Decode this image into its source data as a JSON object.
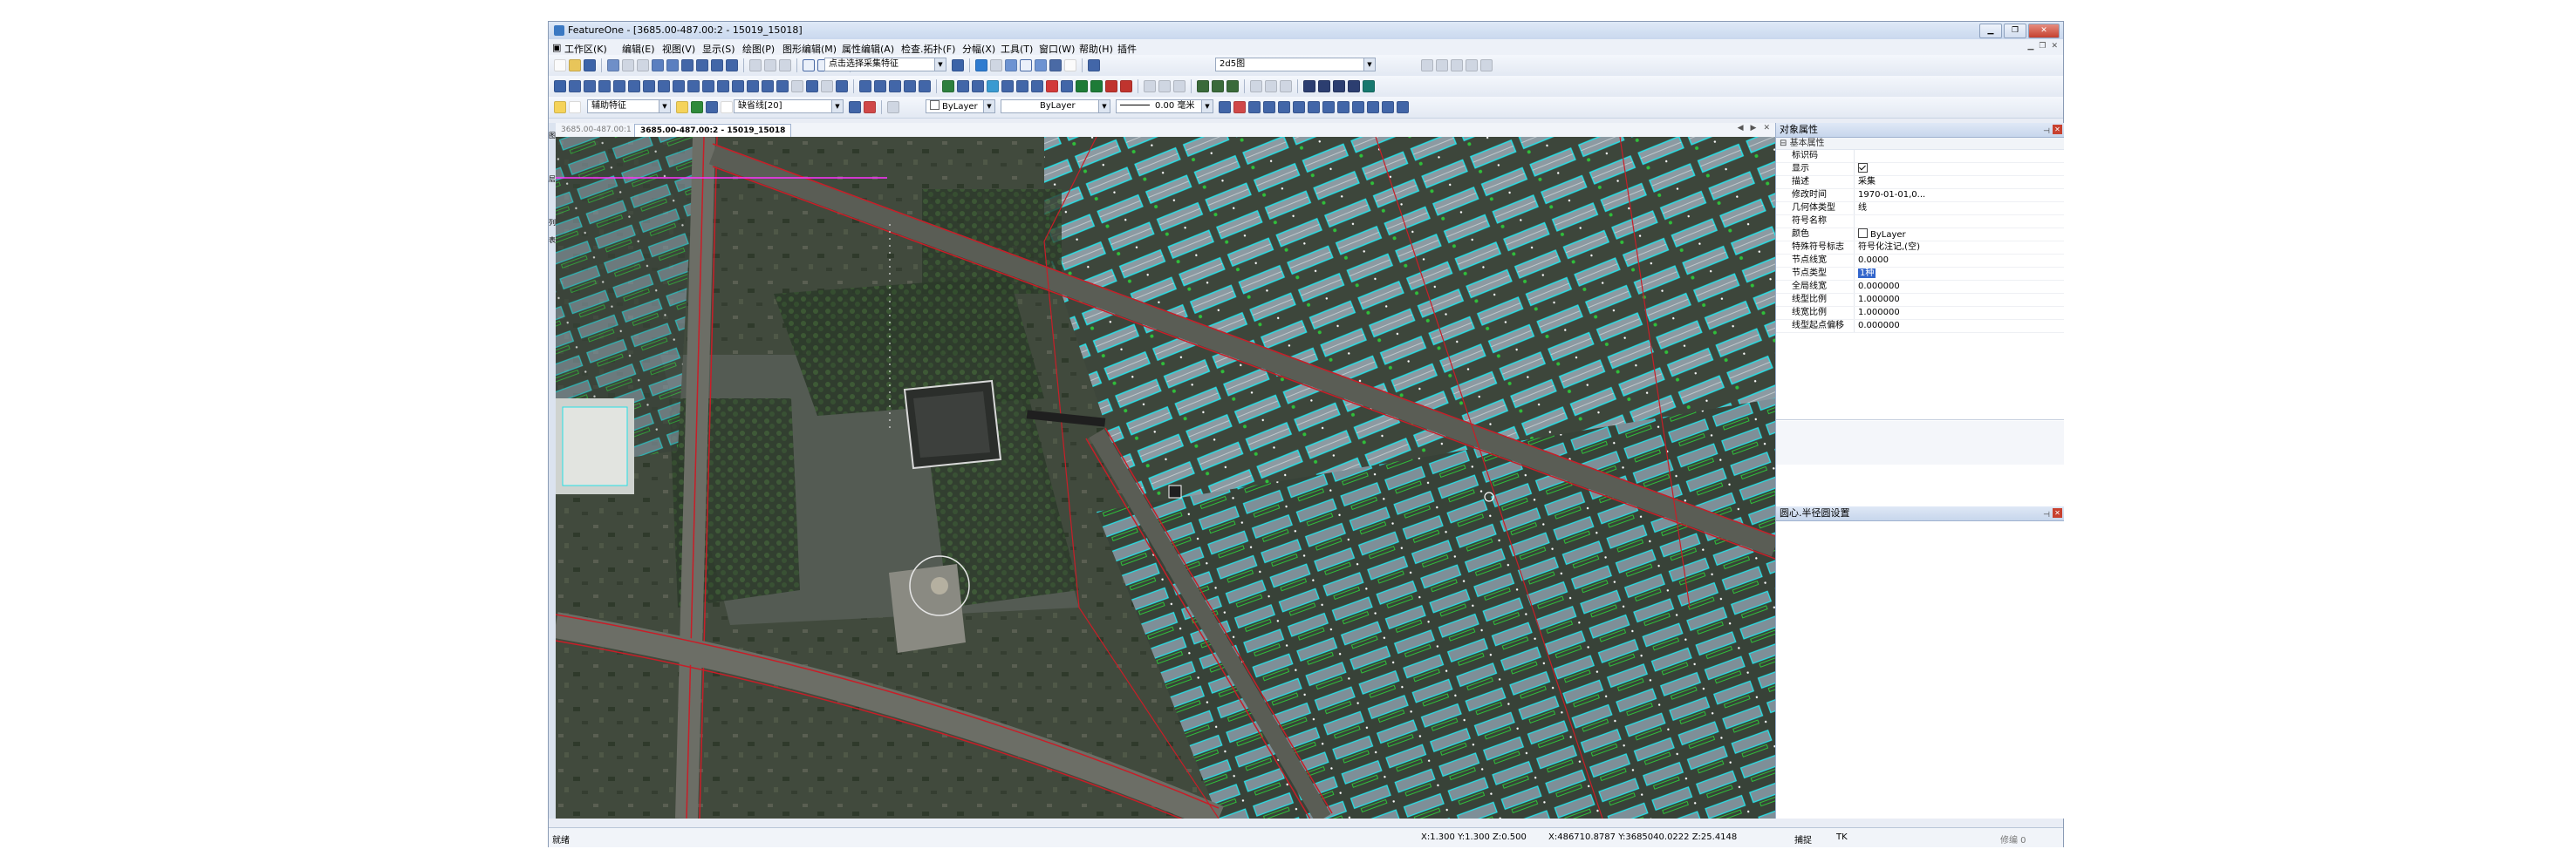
{
  "window": {
    "title": "FeatureOne - [3685.00-487.00:2 - 15019_15018]"
  },
  "menu": [
    "工作区(K)",
    "编辑(E)",
    "视图(V)",
    "显示(S)",
    "绘图(P)",
    "图形编辑(M)",
    "属性编辑(A)",
    "检查.拓扑(F)",
    "分幅(X)",
    "工具(T)",
    "窗口(W)",
    "帮助(H)",
    "插件"
  ],
  "toolbar1": {
    "select_mode": "点击选择采集特征",
    "layer": "2d5图"
  },
  "toolbar3": {
    "aux_feature_label": "辅助特征",
    "missing_line": "缺省线[20]",
    "bylayer_color": "ByLayer",
    "bylayer_linetype": "ByLayer",
    "line_width": "0.00 毫米"
  },
  "tabs": {
    "inactive": "3685.00-487.00:1",
    "active": "3685.00-487.00:2 - 15019_15018"
  },
  "left_strip": [
    "图",
    "层",
    "列",
    "表"
  ],
  "properties_panel": {
    "title": "对象属性",
    "group": "基本属性",
    "rows": [
      {
        "key": "标识码",
        "value": ""
      },
      {
        "key": "显示",
        "value": "",
        "checkbox": true
      },
      {
        "key": "描述",
        "value": "采集"
      },
      {
        "key": "修改时间",
        "value": "1970-01-01,0..."
      },
      {
        "key": "几何体类型",
        "value": "线"
      },
      {
        "key": "符号名称",
        "value": ""
      },
      {
        "key": "颜色",
        "value": "ByLayer",
        "swatch": true
      },
      {
        "key": "特殊符号标志",
        "value": "符号化注记,(空)"
      },
      {
        "key": "节点线宽",
        "value": "0.0000"
      },
      {
        "key": "节点类型",
        "value": "1种",
        "highlight": true
      },
      {
        "key": "全局线宽",
        "value": "0.000000"
      },
      {
        "key": "线型比例",
        "value": "1.000000"
      },
      {
        "key": "线宽比例",
        "value": "1.000000"
      },
      {
        "key": "线型起点偏移",
        "value": "0.000000"
      }
    ]
  },
  "panel2": {
    "title": "圆心.半径圆设置"
  },
  "status": {
    "ready": "就绪",
    "scale": "X:1.300 Y:1.300 Z:0.500",
    "coords": "X:486710.8787 Y:3685040.0222 Z:25.4148",
    "snap": "捕捉",
    "tk": "TK",
    "count": "修编 0"
  },
  "colors": {
    "building_outline": "#27e0e6",
    "road_line": "#c81e28",
    "vegetation_line": "#2fbf3a",
    "selection": "#ff33ff",
    "imagery_dark": "#3a4236"
  }
}
